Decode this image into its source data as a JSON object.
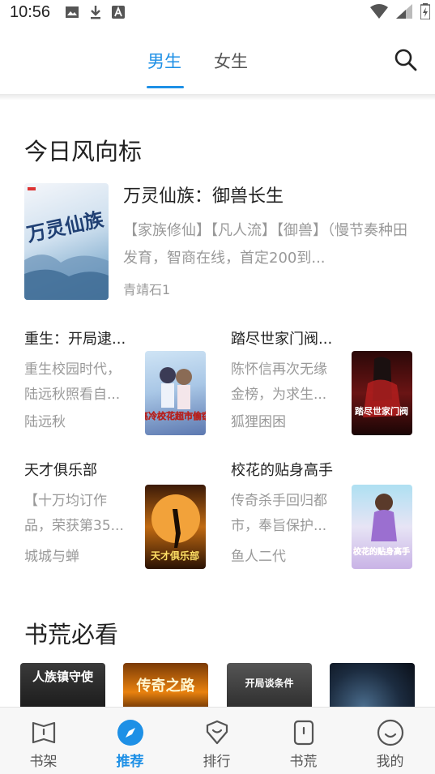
{
  "status_bar": {
    "time": "10:56"
  },
  "tabs": [
    {
      "label": "男生",
      "active": true
    },
    {
      "label": "女生",
      "active": false
    }
  ],
  "accent_color": "#1e90e6",
  "sections": {
    "featured_title": "今日风向标",
    "shelf_title": "书荒必看"
  },
  "featured": {
    "title": "万灵仙族：御兽长生",
    "description": "【家族修仙】【凡人流】【御兽】（慢节奏种田发育，智商在线，首定200到...",
    "author": "青靖石1",
    "cover_text": "万灵仙族"
  },
  "books": [
    {
      "title": "重生：开局逮...",
      "desc": "重生校园时代，陆远秋照看自...",
      "author": "陆远秋",
      "cover_text": "高冷校花超市偷窃"
    },
    {
      "title": "踏尽世家门阀...",
      "desc": "陈怀信再次无缘金榜，为求生...",
      "author": "狐狸困困",
      "cover_text": "踏尽世家门阀"
    },
    {
      "title": "天才俱乐部",
      "desc": "【十万均订作品，荣获第35...",
      "author": "城城与蝉",
      "cover_text": "天才俱乐部"
    },
    {
      "title": "校花的贴身高手",
      "desc": "传奇杀手回归都市，奉旨保护...",
      "author": "鱼人二代",
      "cover_text": "校花的贴身高手"
    }
  ],
  "shelf": [
    {
      "cover_text": "人族镇守使"
    },
    {
      "cover_text": "传奇之路"
    },
    {
      "cover_text": "开局谈条件"
    },
    {
      "cover_text": ""
    }
  ],
  "bottom_nav": [
    {
      "label": "书架",
      "icon": "bookshelf-icon",
      "active": false
    },
    {
      "label": "推荐",
      "icon": "compass-icon",
      "active": true
    },
    {
      "label": "排行",
      "icon": "ranking-icon",
      "active": false
    },
    {
      "label": "书荒",
      "icon": "book-icon",
      "active": false
    },
    {
      "label": "我的",
      "icon": "profile-icon",
      "active": false
    }
  ]
}
